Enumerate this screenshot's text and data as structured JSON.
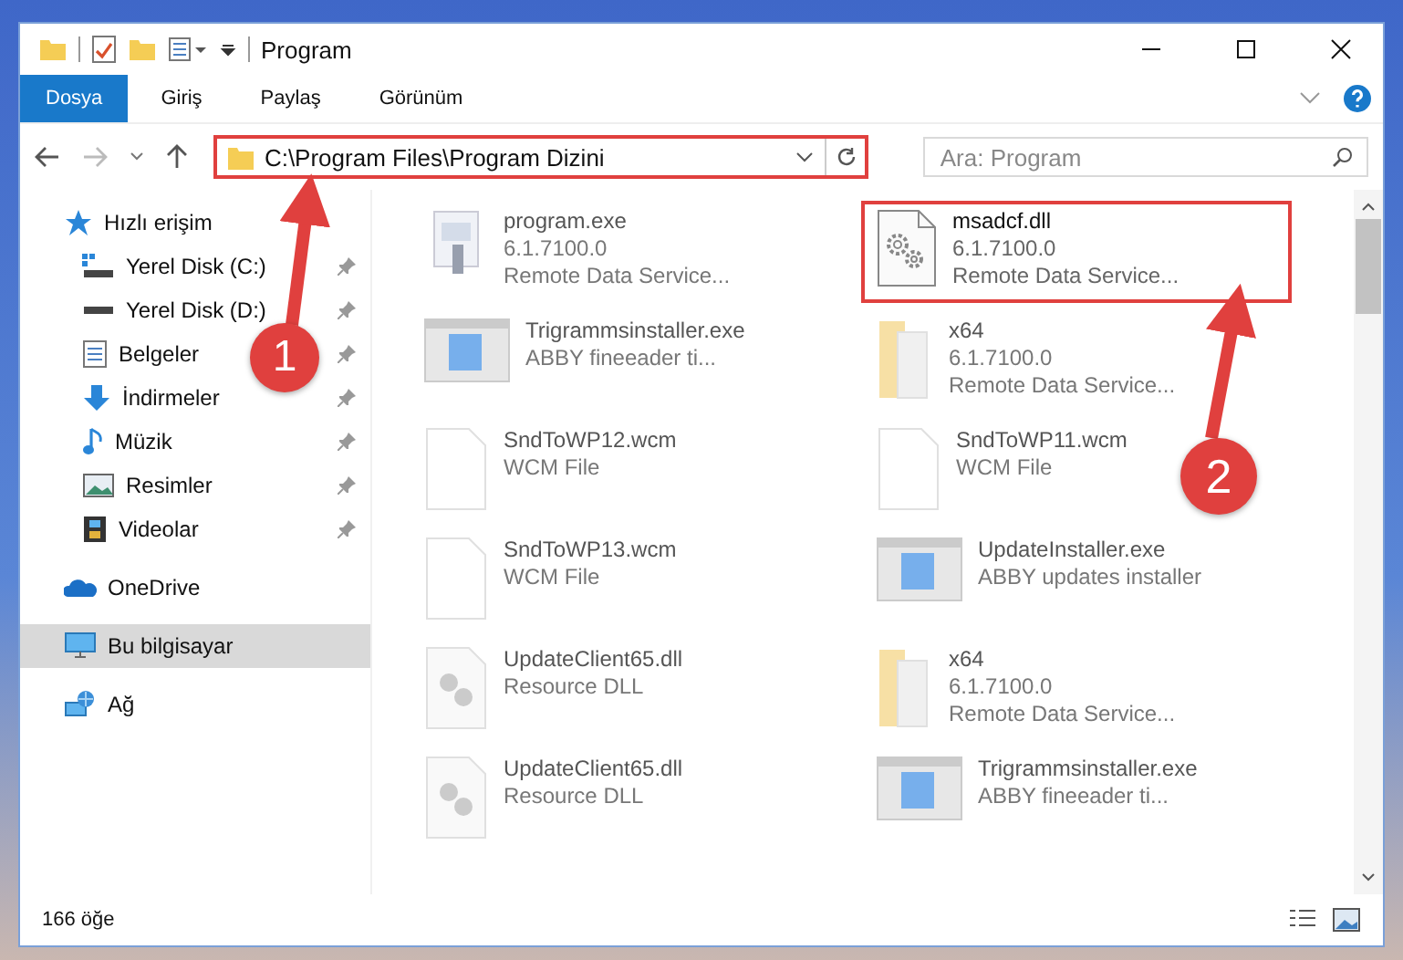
{
  "window": {
    "title": "Program"
  },
  "ribbon_tabs": [
    {
      "label": "Dosya",
      "selected": true
    },
    {
      "label": "Giriş",
      "selected": false
    },
    {
      "label": "Paylaş",
      "selected": false
    },
    {
      "label": "Görünüm",
      "selected": false
    }
  ],
  "address": {
    "path": "C:\\Program Files\\Program Dizini",
    "highlighted": true
  },
  "search": {
    "placeholder": "Ara: Program"
  },
  "sidebar": {
    "items": [
      {
        "label": "Hızlı erişim",
        "kind": "star",
        "selected": false,
        "children": [
          {
            "label": "Yerel Disk (C:)",
            "kind": "drive-c",
            "selected": false,
            "pinned": true
          },
          {
            "label": "Yerel Disk (D:)",
            "kind": "drive",
            "selected": false,
            "pinned": true
          },
          {
            "label": "Belgeler",
            "kind": "document",
            "selected": false,
            "pinned": true
          },
          {
            "label": "İndirmeler",
            "kind": "download",
            "selected": false,
            "pinned": true
          },
          {
            "label": "Müzik",
            "kind": "music",
            "selected": false,
            "pinned": true
          },
          {
            "label": "Resimler",
            "kind": "pictures",
            "selected": false,
            "pinned": true
          },
          {
            "label": "Videolar",
            "kind": "video",
            "selected": false,
            "pinned": true
          }
        ]
      },
      {
        "label": "OneDrive",
        "kind": "cloud",
        "selected": false
      },
      {
        "label": "Bu bilgisayar",
        "kind": "pc",
        "selected": true
      },
      {
        "label": "Ağ",
        "kind": "network",
        "selected": false
      }
    ]
  },
  "files": [
    {
      "name": "program.exe",
      "details": [
        "6.1.7100.0",
        "Remote Data Service..."
      ],
      "kind": "app",
      "highlighted": false,
      "blurred": true
    },
    {
      "name": "msadcf.dll",
      "details": [
        "6.1.7100.0",
        "Remote Data Service..."
      ],
      "kind": "gear-dll",
      "highlighted": true,
      "blurred": false
    },
    {
      "name": "Trigrammsinstaller.exe",
      "details": [
        "ABBY fineeader ti..."
      ],
      "kind": "installer",
      "highlighted": false,
      "blurred": true
    },
    {
      "name": "x64",
      "details": [
        "6.1.7100.0",
        "Remote Data Service..."
      ],
      "kind": "folder",
      "highlighted": false,
      "blurred": true
    },
    {
      "name": "SndToWP12.wcm",
      "details": [
        "WCM File"
      ],
      "kind": "blank",
      "highlighted": false,
      "blurred": true
    },
    {
      "name": "SndToWP11.wcm",
      "details": [
        "WCM File"
      ],
      "kind": "blank",
      "highlighted": false,
      "blurred": true
    },
    {
      "name": "SndToWP13.wcm",
      "details": [
        "WCM File"
      ],
      "kind": "blank",
      "highlighted": false,
      "blurred": true
    },
    {
      "name": "UpdateInstaller.exe",
      "details": [
        "ABBY updates installer"
      ],
      "kind": "installer",
      "highlighted": false,
      "blurred": true
    },
    {
      "name": "UpdateClient65.dll",
      "details": [
        "Resource DLL"
      ],
      "kind": "dll",
      "highlighted": false,
      "blurred": true
    },
    {
      "name": "x64",
      "details": [
        "6.1.7100.0",
        "Remote Data Service..."
      ],
      "kind": "folder",
      "highlighted": false,
      "blurred": true
    },
    {
      "name": "UpdateClient65.dll",
      "details": [
        "Resource DLL"
      ],
      "kind": "dll",
      "highlighted": false,
      "blurred": true
    },
    {
      "name": "Trigrammsinstaller.exe",
      "details": [
        "ABBY fineeader ti..."
      ],
      "kind": "installer",
      "highlighted": false,
      "blurred": true
    }
  ],
  "status_bar": {
    "count": "166 öğe"
  },
  "annotations": [
    {
      "number": "1"
    },
    {
      "number": "2"
    }
  ]
}
